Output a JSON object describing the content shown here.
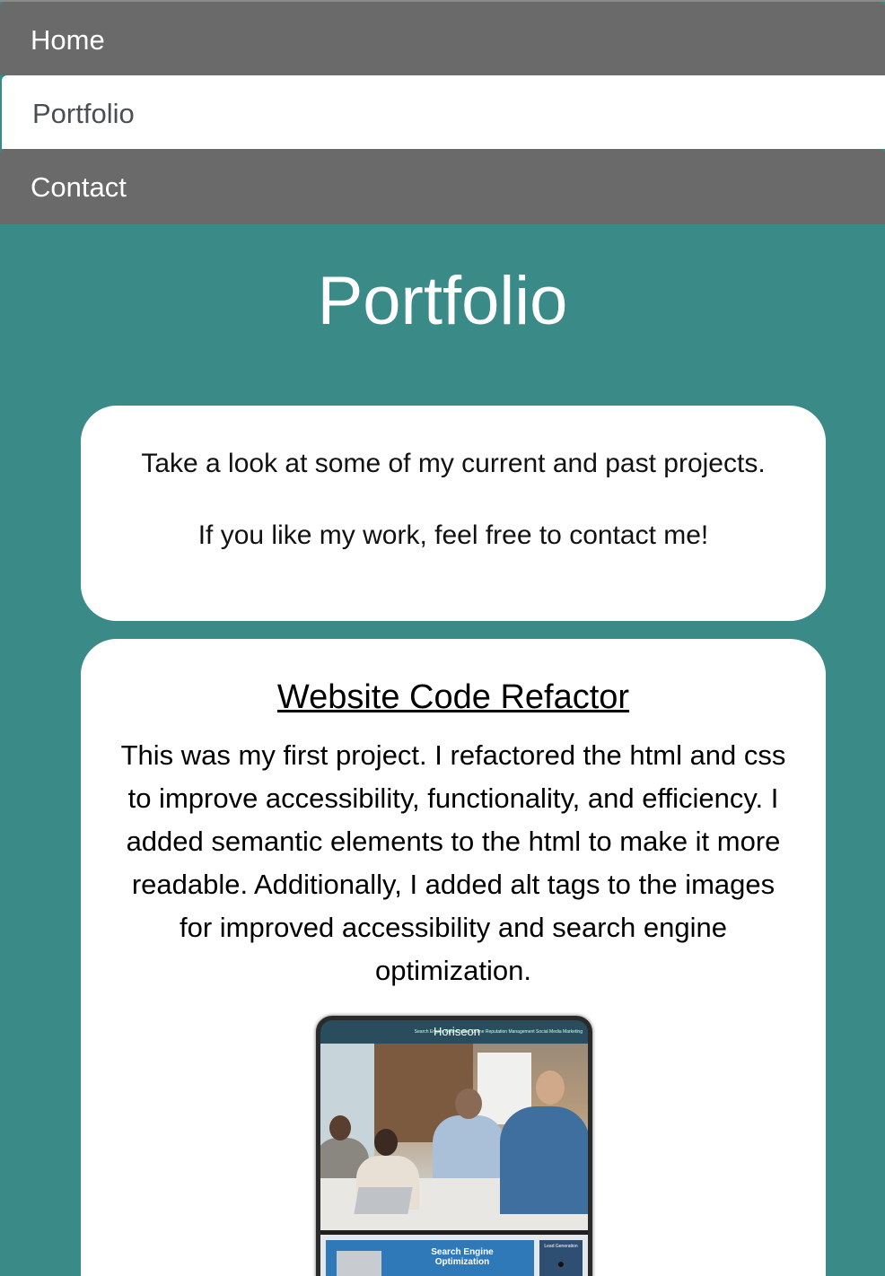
{
  "nav": {
    "items": [
      {
        "label": "Home",
        "active": false
      },
      {
        "label": "Portfolio",
        "active": true
      },
      {
        "label": "Contact",
        "active": false
      }
    ]
  },
  "page": {
    "title": "Portfolio"
  },
  "intro": {
    "line1": "Take a look at some of my current and past projects.",
    "line2": "If you like my work, feel free to contact me!"
  },
  "project": {
    "title": "Website Code Refactor",
    "description": "This was my first project. I refactored the html and css to improve accessibility, functionality, and efficiency. I added semantic elements to the html to make it more readable. Additionally, I added alt tags to the images for improved accessibility and search engine optimization.",
    "screenshot": {
      "brand": "Horiseon",
      "nav": "Search Engine Optimization    Online Reputation Management    Social Media Marketing",
      "section_title": "Search Engine Optimization",
      "side_label": "Lead Generation"
    }
  },
  "colors": {
    "background": "#3a8a88",
    "nav_inactive": "#6a6a6a",
    "nav_active": "#ffffff",
    "card": "#ffffff"
  }
}
